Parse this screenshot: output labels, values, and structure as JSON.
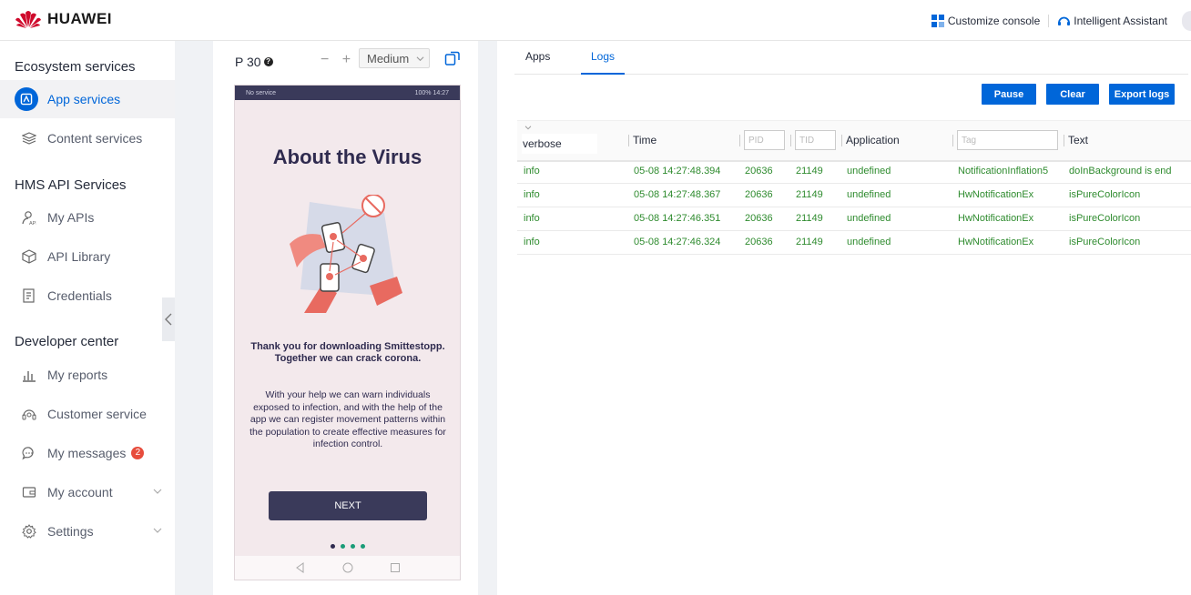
{
  "header": {
    "brand": "HUAWEI",
    "customize_console": "Customize console",
    "assistant": "Intelligent Assistant"
  },
  "sidebar": {
    "sections": [
      {
        "title": "Ecosystem services",
        "items": [
          {
            "label": "App services",
            "icon": "app-services-icon",
            "active": true
          },
          {
            "label": "Content services",
            "icon": "layers-icon"
          }
        ]
      },
      {
        "title": "HMS API Services",
        "items": [
          {
            "label": "My APIs",
            "icon": "user-api-icon"
          },
          {
            "label": "API Library",
            "icon": "cube-icon"
          },
          {
            "label": "Credentials",
            "icon": "document-icon"
          }
        ]
      },
      {
        "title": "Developer center",
        "items": [
          {
            "label": "My reports",
            "icon": "bar-chart-icon"
          },
          {
            "label": "Customer service",
            "icon": "headset-icon"
          },
          {
            "label": "My messages",
            "icon": "chat-icon",
            "badge": "2"
          },
          {
            "label": "My account",
            "icon": "wallet-icon",
            "expandable": true
          },
          {
            "label": "Settings",
            "icon": "gear-icon",
            "expandable": true
          }
        ]
      }
    ]
  },
  "device": {
    "name": "P 30",
    "help": "?",
    "zoom_out": "−",
    "zoom_in": "+",
    "size": "Medium",
    "status_left": "No service",
    "status_right": "100% 14:27",
    "title": "About the Virus",
    "bold_text_1": "Thank you for downloading Smittestopp.",
    "bold_text_2": "Together we can crack corona.",
    "body_text": "With your help we can warn individuals exposed to infection, and with the help of the app we can register movement patterns within the population to create effective measures for infection control.",
    "button": "NEXT",
    "dots": 4
  },
  "logs": {
    "tabs": [
      "Apps",
      "Logs"
    ],
    "active_tab": "Logs",
    "buttons": {
      "pause": "Pause",
      "clear": "Clear",
      "export": "Export logs"
    },
    "level": "verbose",
    "columns": {
      "time": "Time",
      "pid": "PID",
      "tid": "TID",
      "application": "Application",
      "tag": "Tag",
      "text": "Text"
    },
    "rows": [
      {
        "level": "info",
        "time": "05-08 14:27:48.394",
        "pid": "20636",
        "tid": "21149",
        "app": "undefined",
        "tag": "NotificationInflation5",
        "text": "doInBackground is end"
      },
      {
        "level": "info",
        "time": "05-08 14:27:48.367",
        "pid": "20636",
        "tid": "21149",
        "app": "undefined",
        "tag": "HwNotificationEx",
        "text": "isPureColorIcon"
      },
      {
        "level": "info",
        "time": "05-08 14:27:46.351",
        "pid": "20636",
        "tid": "21149",
        "app": "undefined",
        "tag": "HwNotificationEx",
        "text": "isPureColorIcon"
      },
      {
        "level": "info",
        "time": "05-08 14:27:46.324",
        "pid": "20636",
        "tid": "21149",
        "app": "undefined",
        "tag": "HwNotificationEx",
        "text": "isPureColorIcon"
      }
    ]
  },
  "colors": {
    "accent": "#0066d9",
    "log_text": "#2e8b2e",
    "phone_dark": "#3a3a5a",
    "brand_red": "#cf0a2c"
  }
}
